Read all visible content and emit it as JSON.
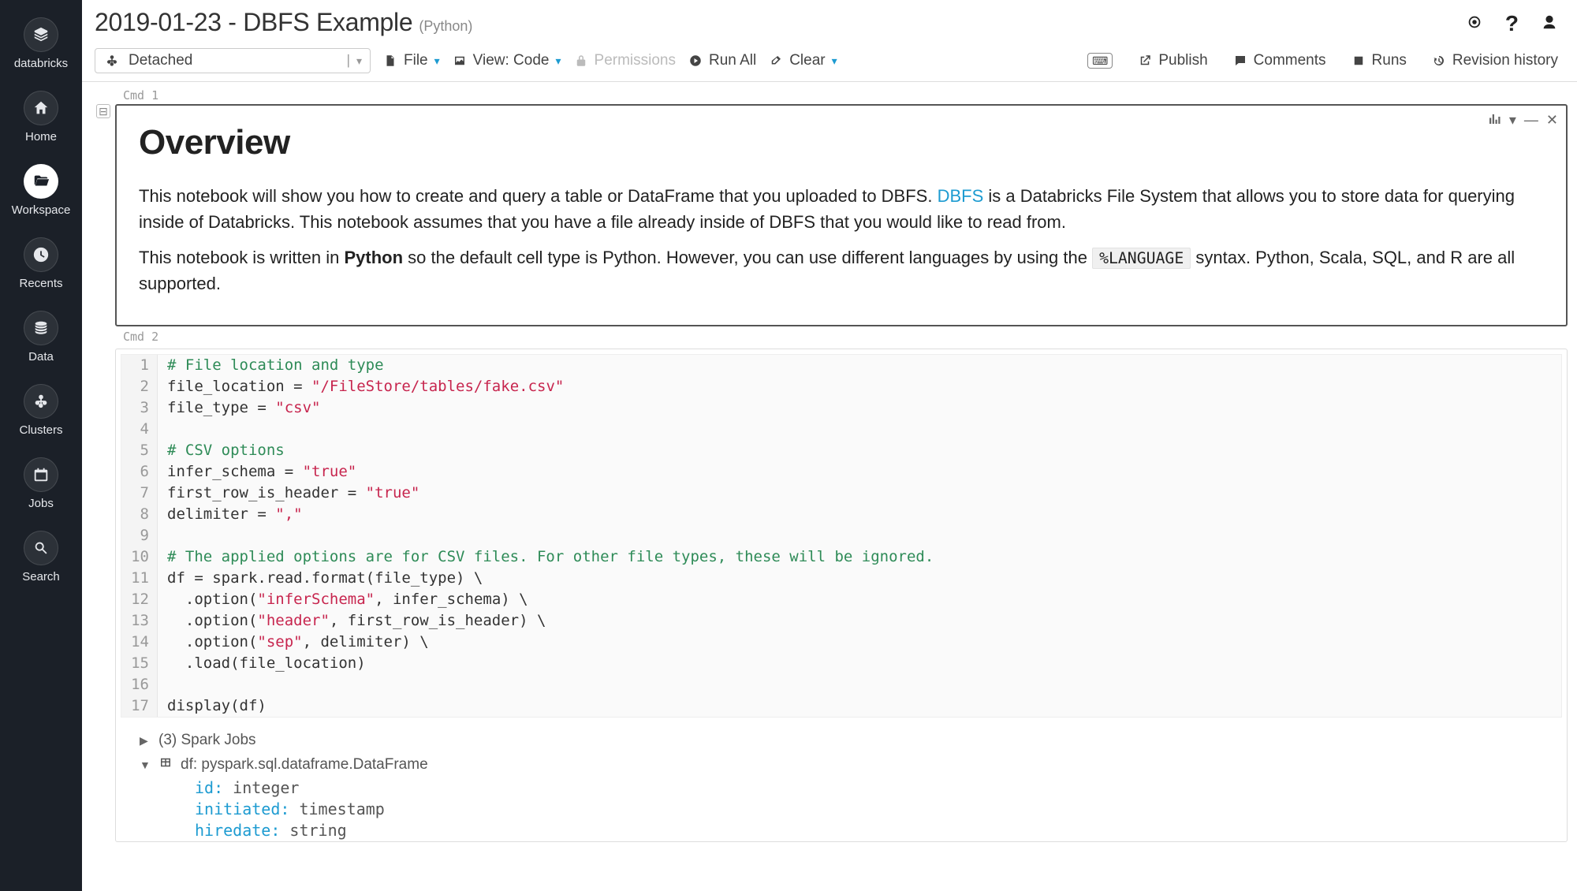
{
  "sidebar": {
    "brand": "databricks",
    "items": [
      {
        "label": "Home"
      },
      {
        "label": "Workspace"
      },
      {
        "label": "Recents"
      },
      {
        "label": "Data"
      },
      {
        "label": "Clusters"
      },
      {
        "label": "Jobs"
      },
      {
        "label": "Search"
      }
    ]
  },
  "header": {
    "title": "2019-01-23 - DBFS Example",
    "lang": "(Python)"
  },
  "toolbar": {
    "cluster": "Detached",
    "file": "File",
    "view": "View: Code",
    "permissions": "Permissions",
    "runall": "Run All",
    "clear": "Clear",
    "publish": "Publish",
    "comments": "Comments",
    "runs": "Runs",
    "revision": "Revision history"
  },
  "cell1": {
    "label": "Cmd 1",
    "heading": "Overview",
    "p1a": "This notebook will show you how to create and query a table or DataFrame that you uploaded to DBFS. ",
    "link": "DBFS",
    "p1b": " is a Databricks File System that allows you to store data for querying inside of Databricks. This notebook assumes that you have a file already inside of DBFS that you would like to read from.",
    "p2a": "This notebook is written in ",
    "p2bold": "Python",
    "p2b": " so the default cell type is Python. However, you can use different languages by using the ",
    "p2code": "%LANGUAGE",
    "p2c": " syntax. Python, Scala, SQL, and R are all supported."
  },
  "cell2": {
    "label": "Cmd 2",
    "lines": [
      {
        "n": "1",
        "comment": "# File location and type"
      },
      {
        "n": "2",
        "pre": "file_location = ",
        "str": "\"/FileStore/tables/fake.csv\""
      },
      {
        "n": "3",
        "pre": "file_type = ",
        "str": "\"csv\""
      },
      {
        "n": "4"
      },
      {
        "n": "5",
        "comment": "# CSV options"
      },
      {
        "n": "6",
        "pre": "infer_schema = ",
        "str": "\"true\""
      },
      {
        "n": "7",
        "pre": "first_row_is_header = ",
        "str": "\"true\""
      },
      {
        "n": "8",
        "pre": "delimiter = ",
        "str": "\",\""
      },
      {
        "n": "9"
      },
      {
        "n": "10",
        "comment": "# The applied options are for CSV files. For other file types, these will be ignored."
      },
      {
        "n": "11",
        "pre": "df = spark.read.format(file_type) \\"
      },
      {
        "n": "12",
        "pre": "  .option(",
        "str": "\"inferSchema\"",
        "post": ", infer_schema) \\"
      },
      {
        "n": "13",
        "pre": "  .option(",
        "str": "\"header\"",
        "post": ", first_row_is_header) \\"
      },
      {
        "n": "14",
        "pre": "  .option(",
        "str": "\"sep\"",
        "post": ", delimiter) \\"
      },
      {
        "n": "15",
        "pre": "  .load(file_location)"
      },
      {
        "n": "16"
      },
      {
        "n": "17",
        "pre": "display(df)"
      }
    ],
    "spark_jobs": "(3) Spark Jobs",
    "df_label": "df:  pyspark.sql.dataframe.DataFrame",
    "schema": [
      {
        "field": "id:",
        "type": "integer"
      },
      {
        "field": "initiated:",
        "type": "timestamp"
      },
      {
        "field": "hiredate:",
        "type": "string"
      }
    ]
  }
}
